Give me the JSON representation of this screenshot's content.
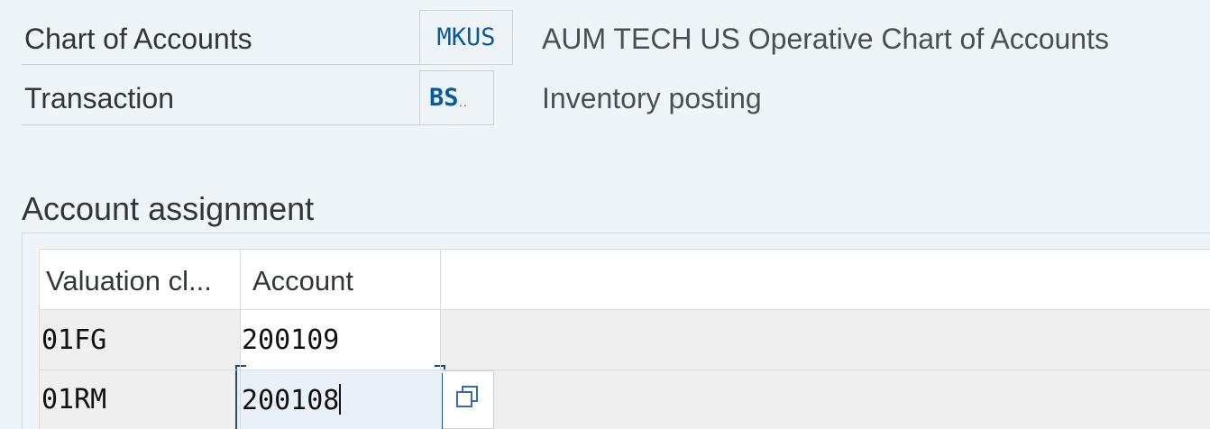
{
  "header": {
    "chart_of_accounts_label": "Chart of Accounts",
    "chart_of_accounts_code": "MKUS",
    "chart_of_accounts_desc": "AUM TECH US Operative Chart of Accounts",
    "transaction_label": "Transaction",
    "transaction_code": "BS",
    "transaction_desc": "Inventory posting"
  },
  "section": {
    "title": "Account assignment"
  },
  "table": {
    "columns": [
      "Valuation cl...",
      "Account"
    ],
    "rows": [
      {
        "valuation_class": "01FG",
        "account": "200109"
      },
      {
        "valuation_class": "01RM",
        "account": "200108"
      }
    ]
  },
  "icons": {
    "value_help": "copy-icon"
  }
}
